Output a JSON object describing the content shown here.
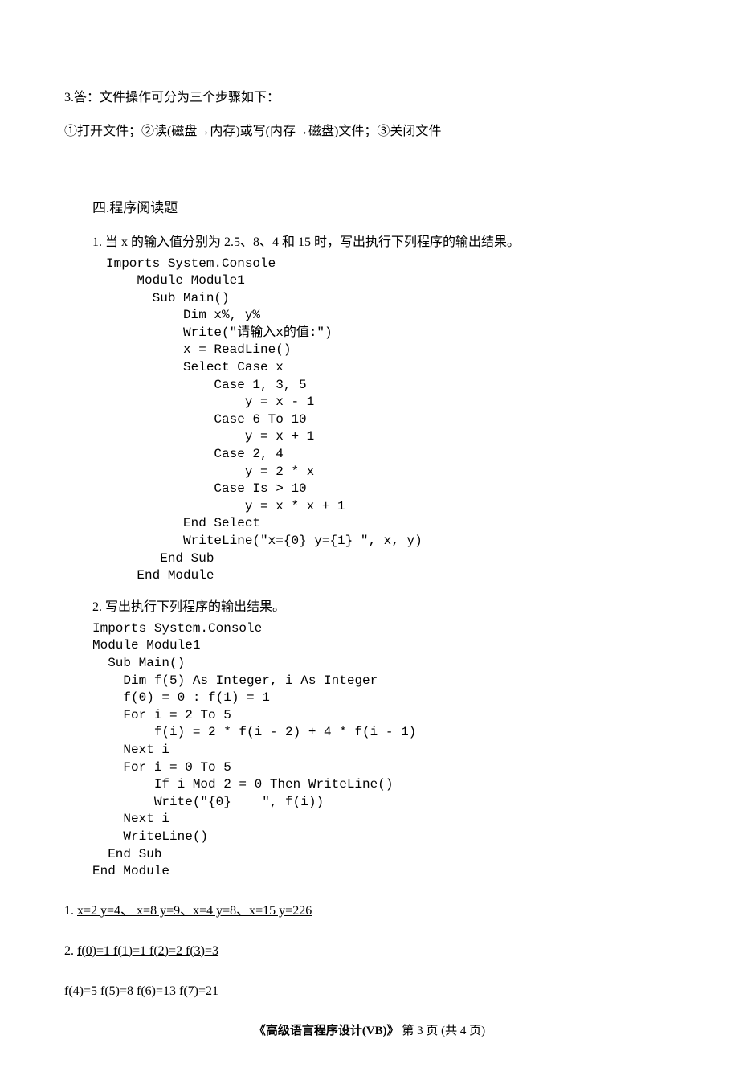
{
  "answer3": {
    "line1": "3.答：文件操作可分为三个步骤如下：",
    "line2": "①打开文件；②读(磁盘→内存)或写(内存→磁盘)文件；③关闭文件"
  },
  "section4_heading": "四.程序阅读题",
  "q1": {
    "intro": "1. 当 x 的输入值分别为 2.5、8、4 和 15 时，写出执行下列程序的输出结果。",
    "code": "Imports System.Console\n    Module Module1\n      Sub Main()\n          Dim x%, y%\n          Write(\"请输入x的值:\")\n          x = ReadLine()\n          Select Case x\n              Case 1, 3, 5\n                  y = x - 1\n              Case 6 To 10\n                  y = x + 1\n              Case 2, 4\n                  y = 2 * x\n              Case Is > 10\n                  y = x * x + 1\n          End Select\n          WriteLine(\"x={0} y={1} \", x, y)\n       End Sub\n    End Module"
  },
  "q2": {
    "intro": "2. 写出执行下列程序的输出结果。",
    "code": "Imports System.Console\nModule Module1\n  Sub Main()\n    Dim f(5) As Integer, i As Integer\n    f(0) = 0 : f(1) = 1\n    For i = 2 To 5\n        f(i) = 2 * f(i - 2) + 4 * f(i - 1)\n    Next i\n    For i = 0 To 5\n        If i Mod 2 = 0 Then WriteLine()\n        Write(\"{0}    \", f(i))\n    Next i\n    WriteLine()\n  End Sub\nEnd Module"
  },
  "answers": {
    "a1_prefix": "1.  ",
    "a1_text": "x=2  y=4、  x=8 y=9、x=4 y=8、x=15 y=226",
    "a2_prefix": "2. ",
    "a2_text": "f(0)=1  f(1)=1  f(2)=2  f(3)=3",
    "a3_text": "f(4)=5  f(5)=8  f(6)=13  f(7)=21"
  },
  "footer": {
    "title": "《高级语言程序设计(VB)》",
    "page_label_prefix": "    第  ",
    "page_current": "3",
    "page_label_mid": "  页  (共  ",
    "page_total": "4",
    "page_label_suffix": "  页)"
  }
}
